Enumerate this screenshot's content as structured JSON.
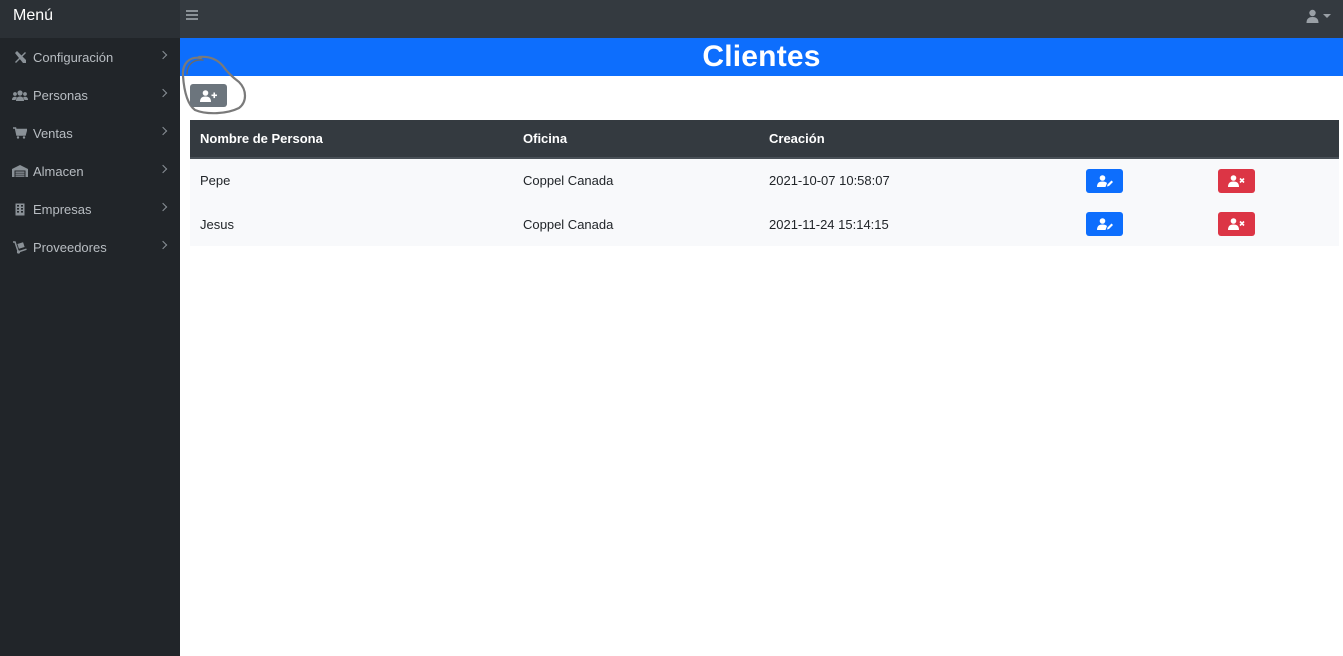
{
  "navbar": {
    "brand": "Menú",
    "icons": {
      "menu": "hamburger-icon",
      "user": "user-icon",
      "caret": "caret-down-icon"
    }
  },
  "sidebar": {
    "items": [
      {
        "label": "Configuración",
        "icon": "tools-icon"
      },
      {
        "label": "Personas",
        "icon": "users-icon"
      },
      {
        "label": "Ventas",
        "icon": "cart-icon"
      },
      {
        "label": "Almacen",
        "icon": "warehouse-icon"
      },
      {
        "label": "Empresas",
        "icon": "building-icon"
      },
      {
        "label": "Proveedores",
        "icon": "dolly-icon"
      }
    ]
  },
  "page": {
    "title": "Clientes",
    "add_button_icon": "user-plus-icon"
  },
  "table": {
    "headers": [
      "Nombre de Persona",
      "Oficina",
      "Creación",
      "",
      ""
    ],
    "rows": [
      {
        "nombre": "Pepe",
        "oficina": "Coppel Canada",
        "creacion": "2021-10-07 10:58:07",
        "edit_icon": "user-edit-icon",
        "delete_icon": "user-times-icon"
      },
      {
        "nombre": "Jesus",
        "oficina": "Coppel Canada",
        "creacion": "2021-11-24 15:14:15",
        "edit_icon": "user-edit-icon",
        "delete_icon": "user-times-icon"
      }
    ]
  },
  "colors": {
    "navbar": "#343a40",
    "sidebar": "#212529",
    "primary": "#0d6efd",
    "danger": "#dc3545",
    "secondary": "#6c757d"
  }
}
